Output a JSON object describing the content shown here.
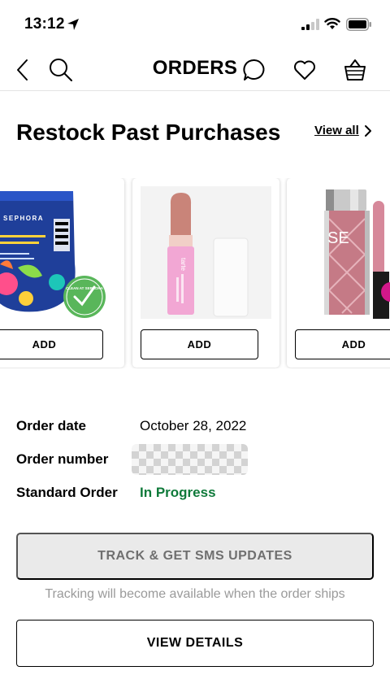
{
  "status_bar": {
    "time": "13:12",
    "icons": [
      "location-arrow-icon",
      "signal-icon",
      "wifi-icon",
      "battery-icon"
    ]
  },
  "nav": {
    "title": "ORDERS",
    "icons": [
      "back-chevron-icon",
      "search-icon",
      "chat-bubble-icon",
      "heart-icon",
      "basket-icon"
    ]
  },
  "restock": {
    "title": "Restock Past Purchases",
    "view_all_label": "View all",
    "products": [
      {
        "image": "sephora-foot-mask-sock-image",
        "brand_text": "SEPHORA",
        "badge_text": "CLEAN AT SEPHORA",
        "add_label": "ADD"
      },
      {
        "image": "tarte-lip-balm-image",
        "brand_text": "tarte",
        "add_label": "ADD"
      },
      {
        "image": "sephora-lip-gloss-image",
        "brand_text": "SE",
        "add_label": "ADD"
      }
    ]
  },
  "order": {
    "date_label": "Order date",
    "date_value": "October 28, 2022",
    "number_label": "Order number",
    "type_label": "Standard Order",
    "status_value": "In Progress"
  },
  "actions": {
    "track_label": "TRACK & GET SMS UPDATES",
    "track_note": "Tracking will become available when the order ships",
    "details_label": "VIEW DETAILS"
  },
  "colors": {
    "status_green": "#0f7a3a",
    "disabled_bg": "#eaeaea",
    "disabled_text": "#6f6f6f",
    "note_text": "#9a9a9a"
  }
}
